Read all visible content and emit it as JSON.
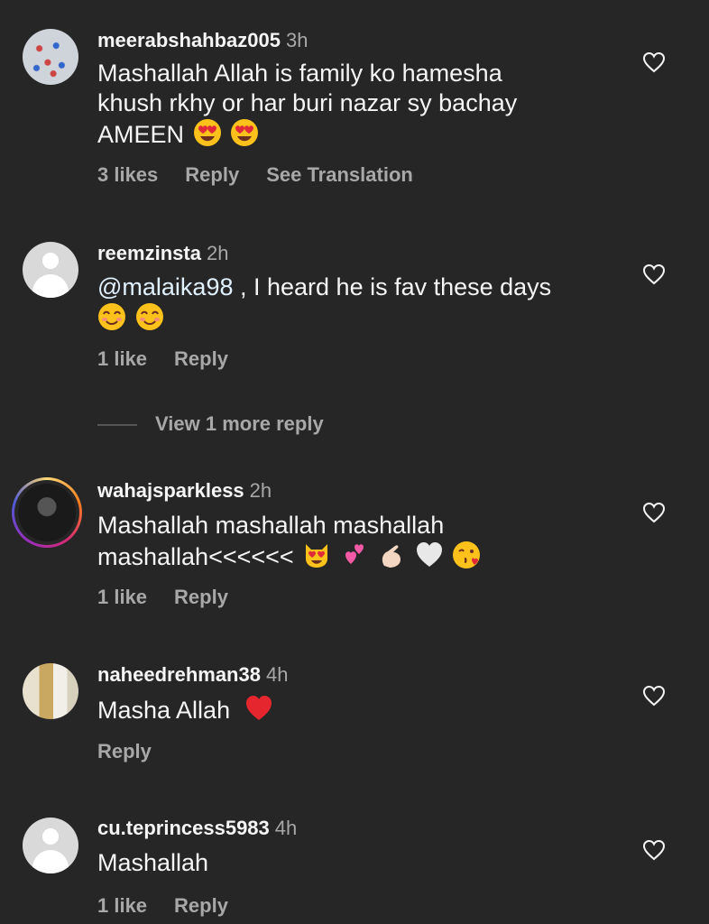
{
  "comments": [
    {
      "username": "meerabshahbaz005",
      "time": "3h",
      "text_lines": [
        "Mashallah Allah is  family ko hamesha",
        "khush rkhy or har buri nazar sy bachay",
        "AMEEN"
      ],
      "emojis": [
        "heart-eyes-emoji",
        "heart-eyes-emoji"
      ],
      "likes": "3 likes",
      "reply": "Reply",
      "translate": "See Translation"
    },
    {
      "username": "reemzinsta",
      "time": "2h",
      "mention": "@malaika98",
      "text": " , I heard he is fav these days",
      "emojis": [
        "smiling-emoji",
        "smiling-emoji"
      ],
      "likes": "1 like",
      "reply": "Reply"
    },
    {
      "username": "wahajsparkless",
      "time": "2h",
      "text_lines": [
        "Mashallah mashallah mashallah",
        "mashallah<<<<<<"
      ],
      "emojis": [
        "heart-eyes-cat-emoji",
        "two-hearts-emoji",
        "pinching-hand-emoji",
        "white-heart-emoji",
        "kissing-heart-emoji"
      ],
      "likes": "1 like",
      "reply": "Reply"
    },
    {
      "username": "naheedrehman38",
      "time": "4h",
      "text": "Masha Allah",
      "emojis": [
        "red-heart-emoji"
      ],
      "reply": "Reply"
    },
    {
      "username": "cu.teprincess5983",
      "time": "4h",
      "text": "Mashallah",
      "likes": "1 like",
      "reply": "Reply"
    }
  ],
  "view_more_replies": "View 1 more reply",
  "colors": {
    "background": "#262626",
    "primary_text": "#f5f5f5",
    "secondary_text": "#a8a8a8",
    "mention": "#e0f1ff"
  }
}
